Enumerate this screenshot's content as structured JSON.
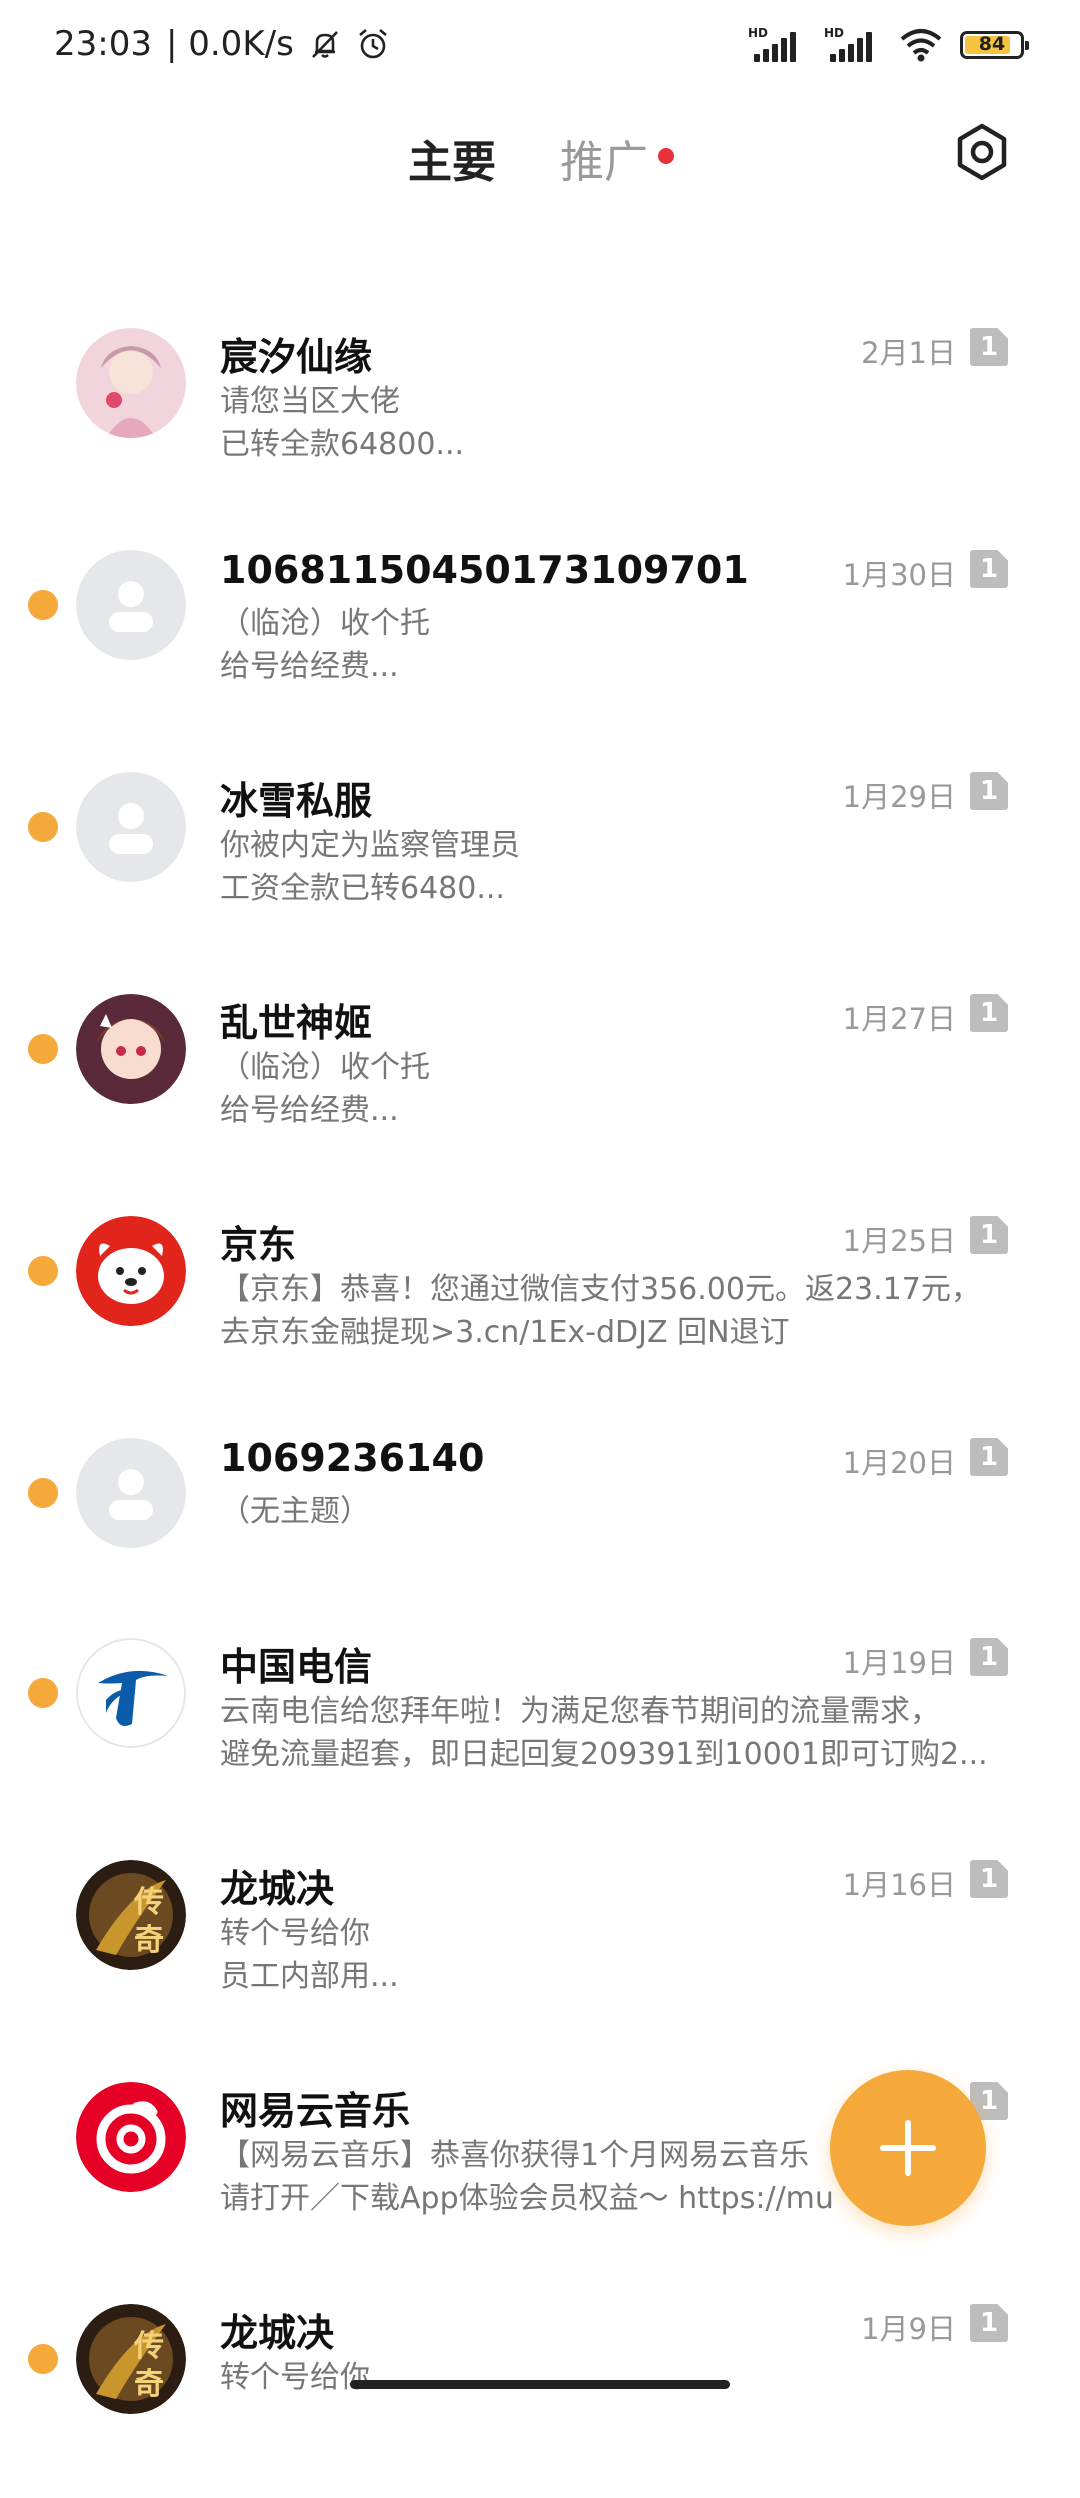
{
  "status_bar": {
    "time": "23:03",
    "speed": "| 0.0K/s",
    "battery": "84",
    "sim1_label": "HD",
    "sim2_label": "HD"
  },
  "header": {
    "tab_main": "主要",
    "tab_promo": "推广",
    "promo_has_badge": true
  },
  "conversations": [
    {
      "name": "宸汐仙缘",
      "date": "2月1日",
      "sim": "1",
      "preview": [
        "请您当区大佬",
        "已转全款64800..."
      ],
      "unread": false,
      "avatar": "fairy-girl"
    },
    {
      "name": "10681150450173109701",
      "date": "1月30日",
      "sim": "1",
      "preview": [
        "（临沧）收个托",
        "给号给经费..."
      ],
      "unread": true,
      "avatar": "default-person"
    },
    {
      "name": "冰雪私服",
      "date": "1月29日",
      "sim": "1",
      "preview": [
        "你被内定为监察管理员",
        "工资全款已转6480..."
      ],
      "unread": true,
      "avatar": "default-person"
    },
    {
      "name": "乱世神姬",
      "date": "1月27日",
      "sim": "1",
      "preview": [
        "（临沧）收个托",
        "给号给经费..."
      ],
      "unread": true,
      "avatar": "anime-girl"
    },
    {
      "name": "京东",
      "date": "1月25日",
      "sim": "1",
      "preview": [
        "【京东】恭喜！您通过微信支付356.00元。返23.17元，",
        "去京东金融提现>3.cn/1Ex-dDJZ 回N退订"
      ],
      "unread": true,
      "avatar": "jd-dog"
    },
    {
      "name": "1069236140",
      "date": "1月20日",
      "sim": "1",
      "preview": [
        "（无主题）"
      ],
      "unread": true,
      "avatar": "default-person"
    },
    {
      "name": "中国电信",
      "date": "1月19日",
      "sim": "1",
      "preview": [
        "云南电信给您拜年啦！为满足您春节期间的流量需求，",
        "避免流量超套，即日起回复209391到10001即可订购2..."
      ],
      "unread": true,
      "avatar": "china-telecom"
    },
    {
      "name": "龙城决",
      "date": "1月16日",
      "sim": "1",
      "preview": [
        "转个号给你",
        "员工内部用..."
      ],
      "unread": false,
      "avatar": "legend-game"
    },
    {
      "name": "网易云音乐",
      "date": "",
      "sim": "1",
      "preview": [
        "【网易云音乐】恭喜你获得1个月网易云音乐",
        "请打开／下载App体验会员权益～ https://mu"
      ],
      "unread": false,
      "avatar": "netease-music"
    },
    {
      "name": "龙城决",
      "date": "1月9日",
      "sim": "1",
      "preview": [
        "转个号给你"
      ],
      "unread": true,
      "avatar": "legend-game"
    }
  ],
  "fab": {
    "icon": "plus-icon"
  },
  "colors": {
    "unread_dot": "#f5a93b",
    "fab": "#f5a93b",
    "promo_badge": "#e8313b"
  }
}
